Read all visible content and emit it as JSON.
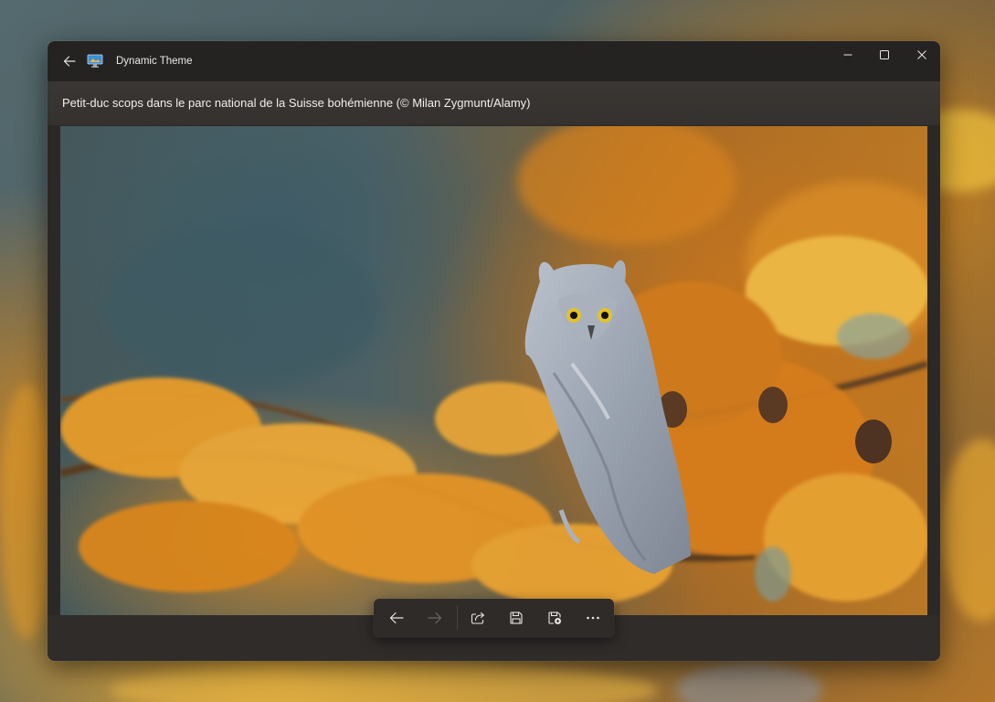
{
  "window": {
    "title": "Dynamic Theme"
  },
  "image": {
    "caption": "Petit-duc scops dans le parc national de la Suisse bohémienne (© Milan Zygmunt/Alamy)"
  },
  "toolbar": {
    "buttons": [
      {
        "icon": "arrow-left-icon",
        "enabled": true
      },
      {
        "icon": "arrow-right-icon",
        "enabled": false
      },
      {
        "icon": "share-icon",
        "enabled": true
      },
      {
        "icon": "save-icon",
        "enabled": true
      },
      {
        "icon": "save-as-icon",
        "enabled": true
      },
      {
        "icon": "more-icon",
        "enabled": true
      }
    ]
  },
  "colors": {
    "window_bg": "#2b2927",
    "titlebar_bg": "#252322",
    "text": "#f0f0f0",
    "disabled_icon": "#6b6866"
  }
}
